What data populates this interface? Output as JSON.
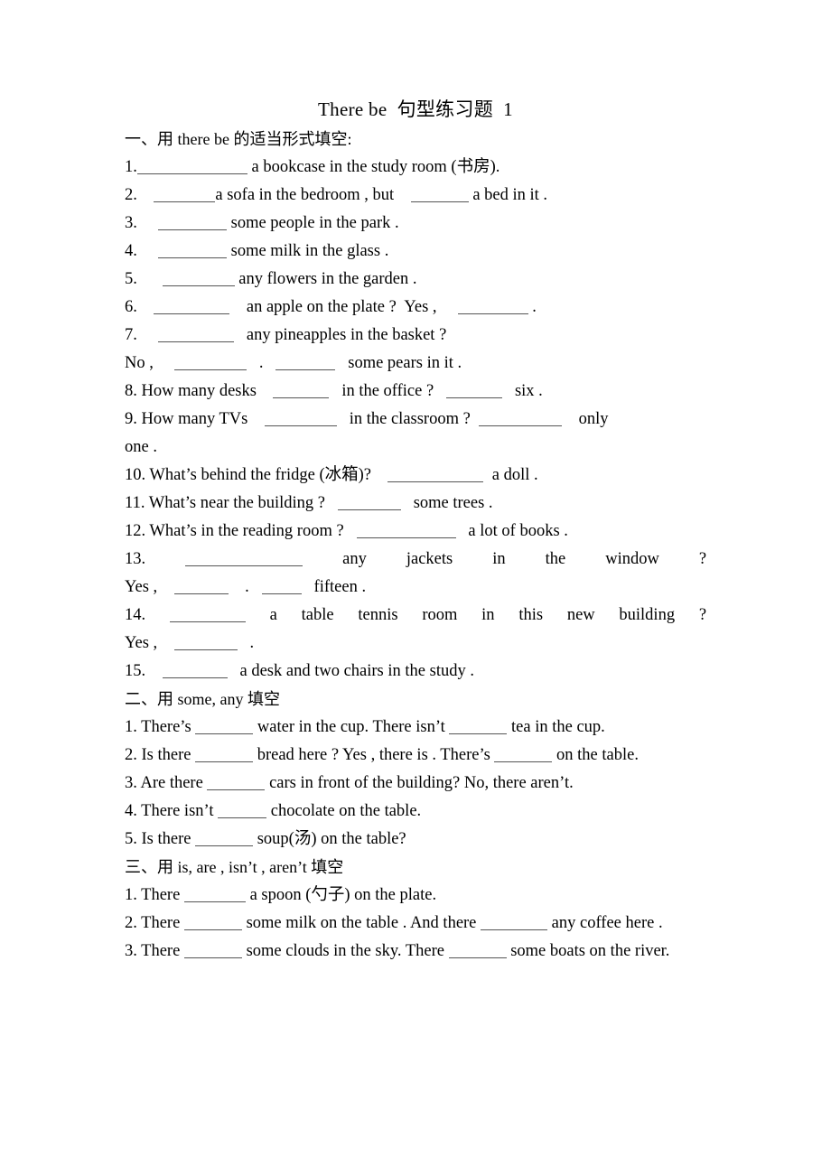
{
  "document": {
    "title": "There be  句型练习题  1",
    "sections": [
      {
        "heading": "一、用 there be 的适当形式填空:",
        "heading_name": "section-1-heading",
        "items": [
          {
            "num": "1.",
            "parts": [
              "",
              " a bookcase in the study room (书房)."
            ],
            "blanks": [
              1
            ],
            "blank_widths": [
              120
            ]
          },
          {
            "num": "2.",
            "parts": [
              "",
              " a sofa in the bedroom , but ",
              " a bed in it ."
            ],
            "blanks": [
              1,
              2
            ],
            "blank_widths": [
              70,
              70
            ]
          },
          {
            "num": "3.",
            "parts": [
              "",
              " some people in the park ."
            ],
            "blanks": [
              1
            ],
            "blank_widths": [
              76
            ]
          },
          {
            "num": "4.",
            "parts": [
              "",
              " some milk in the glass ."
            ],
            "blanks": [
              1
            ],
            "blank_widths": [
              76
            ]
          },
          {
            "num": "5.",
            "parts": [
              "",
              " any flowers in the garden ."
            ],
            "blanks": [
              1
            ],
            "blank_widths": [
              80
            ]
          },
          {
            "num": "6.",
            "parts": [
              "",
              " an apple on the plate ?  Yes ,",
              " ."
            ],
            "blanks": [
              1,
              2
            ],
            "blank_widths": [
              84,
              80
            ]
          },
          {
            "num": "7.",
            "parts": [
              "",
              " any pineapples in the basket ?"
            ],
            "blanks": [
              1
            ],
            "blank_widths": [
              84
            ]
          },
          {
            "num": "No ,",
            "parts": [
              "",
              " . ",
              " some pears in it ."
            ],
            "blanks": [
              1,
              2
            ],
            "blank_widths": [
              80,
              66
            ]
          },
          {
            "num": "8. How many desks",
            "parts": [
              "",
              " in the office ?",
              " six ."
            ],
            "blanks": [
              1,
              2
            ],
            "blank_widths": [
              66,
              66
            ]
          },
          {
            "num": "9. How many TVs",
            "parts": [
              "",
              " in the classroom ?",
              " only"
            ],
            "blanks": [
              1,
              2
            ],
            "blank_widths": [
              80,
              90
            ]
          },
          {
            "num": "one .",
            "parts": [],
            "blanks": [],
            "blank_widths": []
          },
          {
            "num": "10. What’s behind the fridge (冰箱)?",
            "parts": [
              "",
              " a doll ."
            ],
            "blanks": [
              1
            ],
            "blank_widths": [
              104
            ]
          },
          {
            "num": "11. What’s near the building ?",
            "parts": [
              "",
              " some trees ."
            ],
            "blanks": [
              1
            ],
            "blank_widths": [
              72
            ]
          },
          {
            "num": "12. What’s in the reading room ?",
            "parts": [
              "",
              " a lot of books ."
            ],
            "blanks": [
              1
            ],
            "blank_widths": [
              110
            ]
          },
          {
            "num": "13.",
            "parts": [
              "",
              "any jackets in the window ?"
            ],
            "blanks": [
              1
            ],
            "blank_widths": [
              128
            ],
            "justify": true
          },
          {
            "num": "Yes ,",
            "parts": [
              "",
              " . ",
              " fifteen ."
            ],
            "blanks": [
              1,
              2
            ],
            "blank_widths": [
              62,
              44
            ]
          },
          {
            "num": "14.",
            "parts": [
              "",
              "a table tennis room in this new building ?"
            ],
            "blanks": [
              1
            ],
            "blank_widths": [
              84
            ],
            "justify": true
          },
          {
            "num": "Yes ,",
            "parts": [
              "",
              " ."
            ],
            "blanks": [
              1
            ],
            "blank_widths": [
              72
            ]
          },
          {
            "num": "15.",
            "parts": [
              "",
              " a desk and two chairs in the study ."
            ],
            "blanks": [
              1
            ],
            "blank_widths": [
              72
            ]
          }
        ]
      },
      {
        "heading": "二、用 some, any 填空",
        "heading_name": "section-2-heading",
        "items": [
          {
            "num": "1. There’s",
            "parts": [
              "",
              " water in the cup. There isn’t",
              " tea in the cup."
            ],
            "blanks": [
              1,
              2
            ],
            "blank_widths": [
              66,
              66
            ]
          },
          {
            "num": "2. Is there",
            "parts": [
              "",
              "bread here ? Yes , there is . There’s",
              "on the table."
            ],
            "blanks": [
              1,
              2
            ],
            "blank_widths": [
              66,
              66
            ],
            "wrap": true
          },
          {
            "num": "3. Are there",
            "parts": [
              "",
              " cars in front of the building? No, there aren’t."
            ],
            "blanks": [
              1
            ],
            "blank_widths": [
              66
            ]
          },
          {
            "num": "4. There isn’t",
            "parts": [
              "",
              " chocolate on the table."
            ],
            "blanks": [
              1
            ],
            "blank_widths": [
              56
            ]
          },
          {
            "num": "5. Is there",
            "parts": [
              "",
              " soup(汤) on the table?"
            ],
            "blanks": [
              1
            ],
            "blank_widths": [
              66
            ]
          }
        ]
      },
      {
        "heading": "三、用 is, are , isn’t , aren’t 填空",
        "heading_name": "section-3-heading",
        "items": [
          {
            "num": "1. There",
            "parts": [
              "",
              " a spoon (勺子) on the plate."
            ],
            "blanks": [
              1
            ],
            "blank_widths": [
              70
            ]
          },
          {
            "num": "2. There",
            "parts": [
              "",
              " some milk on the table . And there",
              " any coffee here ."
            ],
            "blanks": [
              1,
              2
            ],
            "blank_widths": [
              66,
              76
            ]
          },
          {
            "num": "3. There",
            "parts": [
              "",
              " some clouds in the sky. There",
              " some boats on the river."
            ],
            "blanks": [
              1,
              2
            ],
            "blank_widths": [
              66,
              66
            ]
          }
        ]
      }
    ]
  },
  "lines": {
    "title": "There be  句型练习题  1",
    "s1_head": "一、用 there be 的适当形式填空:",
    "q1_a": "1.",
    "q1_b": "a bookcase in the study room (书房).",
    "q2_a": "2.",
    "q2_b": "a sofa in the bedroom , but",
    "q2_c": "a bed in it .",
    "q3_a": "3.",
    "q3_b": "some people in the park .",
    "q4_a": "4.",
    "q4_b": "some milk in the glass .",
    "q5_a": "5.",
    "q5_b": "any flowers in the garden .",
    "q6_a": "6.",
    "q6_b": "an apple on the plate ?  Yes ,",
    "q6_c": ".",
    "q7_a": "7.",
    "q7_b": "any pineapples in the basket ?",
    "q7b_a": "No ,",
    "q7b_b": ".",
    "q7b_c": "some pears in it .",
    "q8_a": "8. How many desks",
    "q8_b": "in the office ?",
    "q8_c": "six .",
    "q9_a": "9. How many TVs",
    "q9_b": "in the classroom ?",
    "q9_c": "only",
    "q9_d": "one .",
    "q10_a": "10. What’s behind the fridge (冰箱)?",
    "q10_b": "a doll .",
    "q11_a": "11. What’s near the building ?",
    "q11_b": "some trees .",
    "q12_a": "12. What’s in the reading room ?",
    "q12_b": "a lot of books .",
    "q13_a": "13.",
    "q13_b": "any",
    "q13_c": "jackets",
    "q13_d": "in",
    "q13_e": "the",
    "q13_f": "window",
    "q13_g": "?",
    "q13b_a": "Yes ,",
    "q13b_b": ".",
    "q13b_c": "fifteen .",
    "q14_a": "14.",
    "q14_b": "a",
    "q14_c": "table",
    "q14_d": "tennis",
    "q14_e": "room",
    "q14_f": "in",
    "q14_g": "this",
    "q14_h": "new",
    "q14_i": "building",
    "q14_j": "?",
    "q14b_a": "Yes ,",
    "q14b_b": ".",
    "q15_a": "15.",
    "q15_b": "a desk and two chairs in the study .",
    "s2_head": "二、用 some, any 填空",
    "s2q1_a": "1. There’s",
    "s2q1_b": "water in the cup. There isn’t",
    "s2q1_c": "tea in the cup.",
    "s2q2_a": "2. Is there",
    "s2q2_b": "bread here ? Yes , there is . There’s",
    "s2q2_c": "on the",
    "s2q2_d": "table.",
    "s2q3_a": "3. Are there",
    "s2q3_b": "cars in front of the building? No, there aren’t.",
    "s2q4_a": "4. There isn’t",
    "s2q4_b": "chocolate on the table.",
    "s2q5_a": "5. Is there",
    "s2q5_b": "soup(汤) on the table?",
    "s3_head": "三、用 is, are , isn’t , aren’t 填空",
    "s3q1_a": "1. There",
    "s3q1_b": "a spoon (勺子) on the plate.",
    "s3q2_a": "2. There",
    "s3q2_b": "some milk on the table . And there",
    "s3q2_c": "any coffee",
    "s3q2_d": "here .",
    "s3q3_a": "3. There",
    "s3q3_b": "some clouds in the sky. There",
    "s3q3_c": "some boats on the",
    "s3q3_d": "river."
  }
}
